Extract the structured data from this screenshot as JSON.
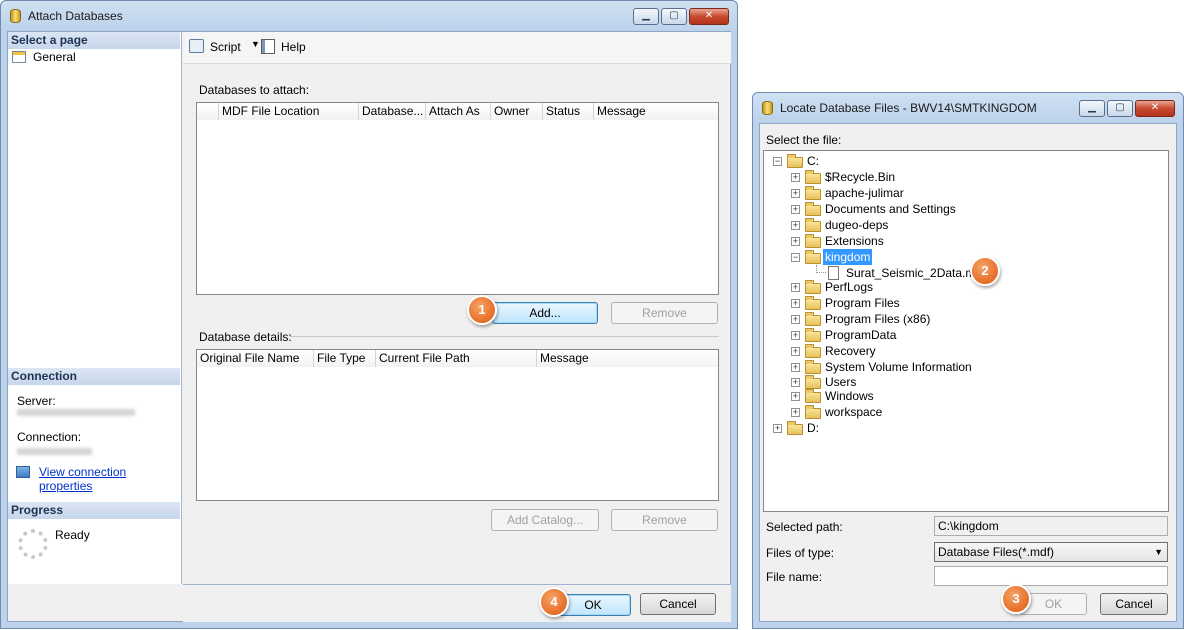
{
  "left_window": {
    "title": "Attach Databases",
    "sidebar": {
      "select_page_header": "Select a page",
      "pages": [
        "General"
      ],
      "connection_header": "Connection",
      "server_label": "Server:",
      "connection_label": "Connection:",
      "view_connection_link": "View connection properties",
      "progress_header": "Progress",
      "progress_status": "Ready"
    },
    "toolbar": {
      "script_label": "Script",
      "help_label": "Help"
    },
    "databases_to_attach_label": "Databases to attach:",
    "attach_columns": [
      "MDF File Location",
      "Database...",
      "Attach As",
      "Owner",
      "Status",
      "Message"
    ],
    "add_button": "Add...",
    "remove_button": "Remove",
    "database_details_label": "Database details:",
    "details_columns": [
      "Original File Name",
      "File Type",
      "Current File Path",
      "Message"
    ],
    "add_catalog_button": "Add Catalog...",
    "remove_button_2": "Remove",
    "ok_button": "OK",
    "cancel_button": "Cancel"
  },
  "right_window": {
    "title": "Locate Database Files - BWV14\\SMTKINGDOM",
    "select_file_label": "Select the file:",
    "tree": {
      "root_c": "C:",
      "c_children": [
        "$Recycle.Bin",
        "apache-julimar",
        "Documents and Settings",
        "dugeo-deps",
        "Extensions",
        "kingdom",
        "PerfLogs",
        "Program Files",
        "Program Files (x86)",
        "ProgramData",
        "Recovery",
        "System Volume Information",
        "Users",
        "Windows",
        "workspace"
      ],
      "selected_folder": "kingdom",
      "file": "Surat_Seismic_2Data.mdf",
      "root_d": "D:"
    },
    "selected_path_label": "Selected path:",
    "selected_path_value": "C:\\kingdom",
    "files_of_type_label": "Files of type:",
    "files_of_type_value": "Database Files(*.mdf)",
    "file_name_label": "File name:",
    "file_name_value": "",
    "ok_button": "OK",
    "cancel_button": "Cancel"
  },
  "callouts": [
    "1",
    "2",
    "3",
    "4"
  ],
  "colors": {
    "callout": "#e8742f",
    "selection": "#3399ff",
    "link": "#0033cc"
  }
}
